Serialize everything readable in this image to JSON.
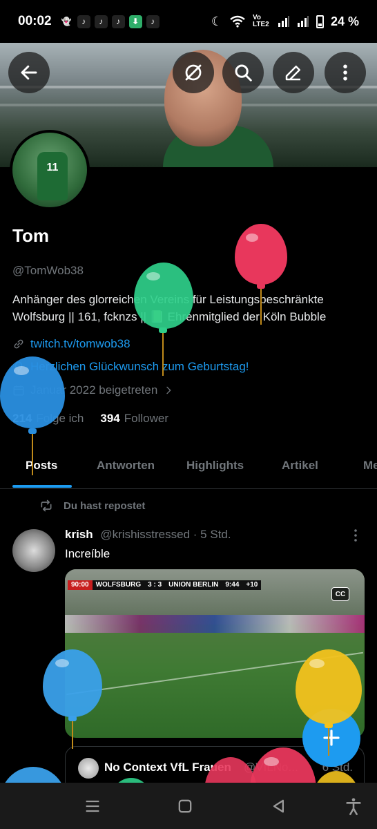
{
  "status_bar": {
    "time": "00:02",
    "network": "Vo LTE2",
    "battery": "24 %"
  },
  "profile": {
    "name": "Tom",
    "handle": "@TomWob38",
    "bio_line1": "Anhänger des glorreichen Vereins für Leistungsbeschränkte",
    "bio_line2": "Wolfsburg || 161, fcknzs || 📗 Ehrenmitglied der Köln Bubble",
    "website": "twitch.tv/tomwob38",
    "birthday": "Herzlichen Glückwunsch zum Geburtstag!",
    "joined": "Januar 2022 beigetreten",
    "following_count": "214",
    "following_label": "Folge ich",
    "followers_count": "394",
    "followers_label": "Follower"
  },
  "tabs": [
    "Posts",
    "Antworten",
    "Highlights",
    "Artikel",
    "Me"
  ],
  "post": {
    "repost_label": "Du hast repostet",
    "author": "krish",
    "handle": "@krishisstressed",
    "time": "· 5 Std.",
    "text": "Increíble",
    "scoreboard": {
      "clock": "90:00",
      "home": "WOLFSBURG",
      "score": "3 : 3",
      "away": "UNION BERLIN",
      "extra_clock": "9:44",
      "extra": "+10"
    },
    "cc_label": "CC",
    "quote": {
      "author": "No Context VfL Frauen",
      "handle": "@VfLNo...",
      "time": "6 Std."
    }
  },
  "icons": {
    "back": "arrow-left-icon",
    "circle_slash": "hidden-icon",
    "search": "search-icon",
    "edit": "pencil-icon",
    "more": "more-vertical-icon",
    "compose": "plus-icon"
  },
  "colors": {
    "accent": "#1d9bf0",
    "text_muted": "#71767b",
    "balloon_red": "#e8375c",
    "balloon_green": "#2fcf8a",
    "balloon_blue": "#2a8fe0",
    "balloon_yellow": "#f2c21e"
  }
}
